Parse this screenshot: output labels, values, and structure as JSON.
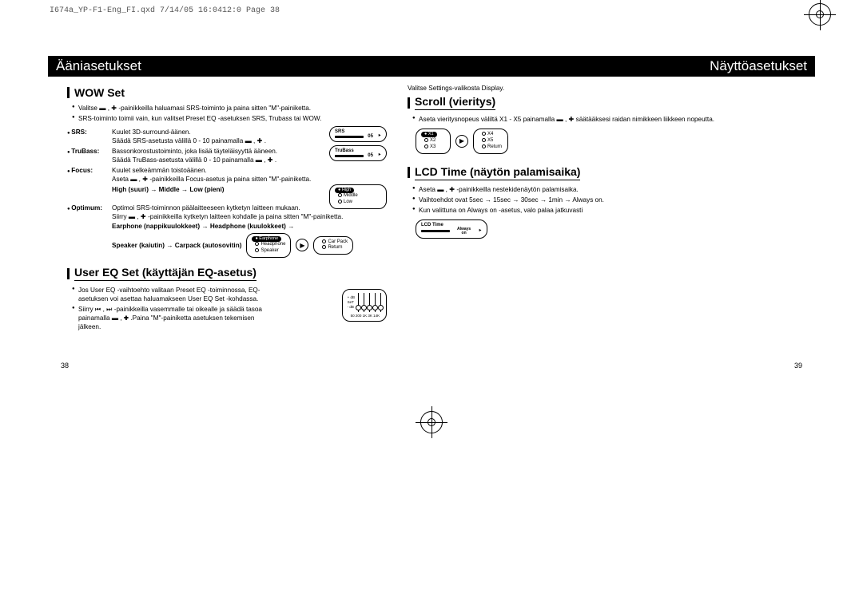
{
  "header": "I674a_YP-F1-Eng_FI.qxd  7/14/05 16:0412:0  Page 38",
  "band": {
    "left": "Ääniasetukset",
    "right": "Näyttöasetukset"
  },
  "wow": {
    "title": "WOW Set",
    "b1": "Valitse ▬ , ✚ -painikkeilla haluamasi SRS-toiminto ja paina sitten \"M\"-painiketta.",
    "b2": "SRS-toiminto toimii vain, kun valitset Preset EQ -asetuksen SRS, Trubass tai WOW.",
    "srs_label": "SRS:",
    "srs_l1": "Kuulet 3D-surround-äänen.",
    "srs_l2": "Säädä SRS-asetusta välillä 0 - 10 painamalla ▬ , ✚ .",
    "tru_label": "TruBass:",
    "tru_l1": "Bassonkorostustoiminto, joka lisää täyteläisyyttä ääneen.",
    "tru_l2": "Säädä TruBass-asetusta välillä 0 - 10 painamalla ▬ , ✚ .",
    "foc_label": "Focus:",
    "foc_l1": "Kuulet selkeämmän toistoäänen.",
    "foc_l2": "Aseta ▬ , ✚ -painikkeilla Focus-asetus ja paina sitten \"M\"-painiketta.",
    "foc_chain": "High (suuri) → Middle → Low (pieni)",
    "opt_label": "Optimum:",
    "opt_l1": "Optimoi SRS-toiminnon päälaitteeseen kytketyn laitteen mukaan.",
    "opt_l2": "Siirry ▬ , ✚ -painikkeilla kytketyn laitteen kohdalle ja paina sitten \"M\"-painiketta.",
    "opt_chain1": "Earphone (nappikuulokkeet) → Headphone (kuulokkeet) →",
    "opt_chain2": "Speaker (kaiutin) → Carpack (autosovitin)",
    "dev_srs": {
      "name": "SRS",
      "val": "05"
    },
    "dev_tru": {
      "name": "TruBass",
      "val": "05"
    },
    "dev_hml": {
      "sel": "High",
      "m": "Middle",
      "l": "Low"
    },
    "dev_out": {
      "sel": "Earphone",
      "o1": "Headphone",
      "o2": "Speaker",
      "o3": "Car Pack",
      "o4": "Return"
    }
  },
  "usereq": {
    "title": "User EQ Set (käyttäjän EQ-asetus)",
    "b1": "Jos User EQ -vaihtoehto valitaan Preset EQ -toiminnossa, EQ-asetuksen voi asettaa haluamakseen User EQ Set -kohdassa.",
    "b2": "Siirry ⏮ , ⏭ -painikkeilla vasemmalle tai oikealle ja säädä tasoa painamalla ▬ , ✚ .Paina \"M\"-painiketta asetuksen tekemisen jälkeen.",
    "eq_freqs": "50  200  1K  3K  14K",
    "eq_db": "+ dB\nSeT\n- dB"
  },
  "rightcol": {
    "note": "Valitse Settings-valikosta Display.",
    "scroll_title": "Scroll (vieritys)",
    "scroll_b1": "Aseta vieritysnopeus väliltä X1 - X5 painamalla ▬ , ✚ säätääksesi raidan nimikkeen liikkeen nopeutta.",
    "dev_x": {
      "sel": "X1",
      "o1": "X2",
      "o2": "X3",
      "o3": "X4",
      "o4": "X5",
      "o5": "Return"
    },
    "lcd_title": "LCD Time (näytön palamisaika)",
    "lcd_b1": "Aseta ▬ , ✚ -painikkeilla nestekidenäytön palamisaika.",
    "lcd_b2": "Vaihtoehdot ovat 5sec → 15sec → 30sec → 1min → Always on.",
    "lcd_b3": "Kun valittuna on Always on -asetus, valo palaa jatkuvasti",
    "dev_lcd": {
      "name": "LCD Time",
      "val": "Always\non"
    }
  },
  "pages": {
    "left": "38",
    "right": "39"
  }
}
